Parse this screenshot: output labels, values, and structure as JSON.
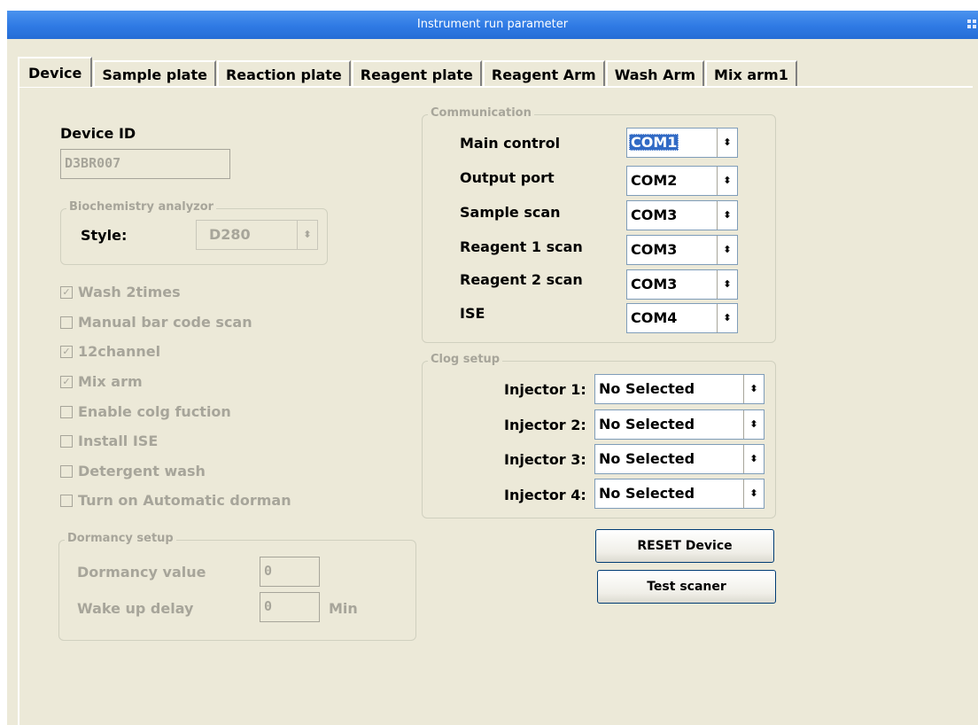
{
  "window": {
    "title": "Instrument run parameter"
  },
  "tabs": [
    {
      "label": "Device",
      "active": true
    },
    {
      "label": "Sample plate"
    },
    {
      "label": "Reaction plate"
    },
    {
      "label": "Reagent plate"
    },
    {
      "label": "Reagent Arm"
    },
    {
      "label": "Wash Arm"
    },
    {
      "label": "Mix arm1"
    }
  ],
  "device": {
    "label": "Device ID",
    "value": "D3BR007",
    "biochem_group": {
      "title": "Biochemistry analyzor",
      "style_label": "Style:",
      "style_value": "D280"
    },
    "checkboxes": [
      {
        "label": "Wash 2times",
        "checked": true,
        "mark": "✓"
      },
      {
        "label": "Manual bar code scan",
        "checked": false,
        "mark": ""
      },
      {
        "label": "12channel",
        "checked": true,
        "mark": "✓"
      },
      {
        "label": "Mix arm",
        "checked": true,
        "mark": "✓"
      },
      {
        "label": "Enable colg fuction",
        "checked": false,
        "mark": ""
      },
      {
        "label": "Install ISE",
        "checked": false,
        "mark": ""
      },
      {
        "label": "Detergent wash",
        "checked": false,
        "mark": ""
      },
      {
        "label": "Turn on Automatic dorman",
        "checked": false,
        "mark": ""
      }
    ],
    "dormancy": {
      "title": "Dormancy setup",
      "value_label": "Dormancy value",
      "value": "0",
      "delay_label": "Wake up delay",
      "delay": "0",
      "unit": "Min"
    }
  },
  "communication": {
    "title": "Communication",
    "rows": [
      {
        "label": "Main control",
        "value": "COM1"
      },
      {
        "label": "Output port",
        "value": "COM2"
      },
      {
        "label": "Sample scan",
        "value": "COM3"
      },
      {
        "label": "Reagent 1 scan",
        "value": "COM3"
      },
      {
        "label": "Reagent 2 scan",
        "value": "COM3"
      },
      {
        "label": "ISE",
        "value": "COM4"
      }
    ]
  },
  "clog": {
    "title": "Clog setup",
    "rows": [
      {
        "label": "Injector 1:",
        "value": "No Selected"
      },
      {
        "label": "Injector 2:",
        "value": "No Selected"
      },
      {
        "label": "Injector 3:",
        "value": "No Selected"
      },
      {
        "label": "Injector 4:",
        "value": "No Selected"
      }
    ]
  },
  "buttons": {
    "reset": "RESET Device",
    "test": "Test scaner"
  },
  "icons": {
    "spin": "updown-arrows-icon",
    "grip": "window-grip-icon"
  }
}
